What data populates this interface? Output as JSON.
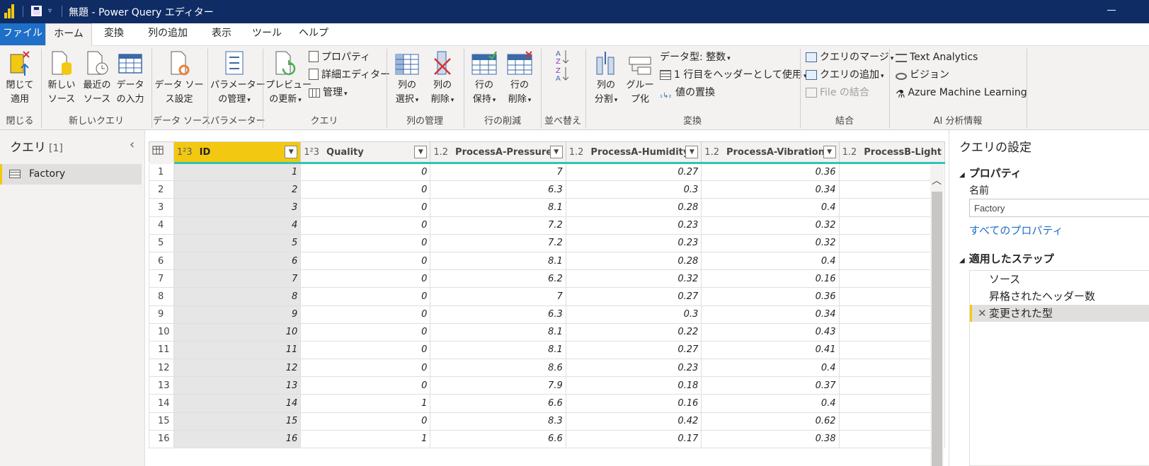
{
  "titlebar": {
    "title": "無題 - Power Query エディター"
  },
  "tabs": [
    "ファイル",
    "ホーム",
    "変換",
    "列の追加",
    "表示",
    "ツール",
    "ヘルプ"
  ],
  "ribbon": {
    "close_apply": "閉じて\n適用",
    "new_source": "新しい\nソース",
    "recent_sources": "最近の\nソース",
    "enter_data": "データ\nの入力",
    "data_source_settings": "データ ソー\nス設定",
    "manage_parameters": "パラメーター\nの管理",
    "refresh_preview": "プレビュー\nの更新",
    "properties": "プロパティ",
    "advanced_editor": "詳細エディター",
    "manage": "管理",
    "choose_columns": "列の\n選択",
    "remove_columns": "列の\n削除",
    "keep_rows": "行の\n保持",
    "remove_rows": "行の\n削除",
    "split_column": "列の\n分割",
    "group_by": "グルー\nプ化",
    "data_type": "データ型: 整数",
    "use_first_row": "1 行目をヘッダーとして使用",
    "replace_values": "値の置換",
    "merge_queries": "クエリのマージ",
    "append_queries": "クエリの追加",
    "combine_files": "File の結合",
    "text_analytics": "Text Analytics",
    "vision": "ビジョン",
    "azure_ml": "Azure Machine Learning",
    "groups": {
      "close": "閉じる",
      "new_query": "新しいクエリ",
      "data_sources": "データ ソース",
      "parameters": "パラメーター",
      "query": "クエリ",
      "manage_columns": "列の管理",
      "reduce_rows": "行の削減",
      "sort": "並べ替え",
      "transform": "変換",
      "combine": "結合",
      "ai_insights": "AI 分析情報"
    }
  },
  "queries": {
    "title": "クエリ",
    "count": "[1]",
    "items": [
      "Factory"
    ]
  },
  "table": {
    "columns": [
      {
        "type": "1²3",
        "name": "ID"
      },
      {
        "type": "1²3",
        "name": "Quality"
      },
      {
        "type": "1.2",
        "name": "ProcessA-Pressure"
      },
      {
        "type": "1.2",
        "name": "ProcessA-Humidity"
      },
      {
        "type": "1.2",
        "name": "ProcessA-Vibration"
      },
      {
        "type": "1.2",
        "name": "ProcessB-Light"
      }
    ],
    "rows": [
      [
        "1",
        "1",
        "0",
        "7",
        "0.27",
        "0.36"
      ],
      [
        "2",
        "2",
        "0",
        "6.3",
        "0.3",
        "0.34"
      ],
      [
        "3",
        "3",
        "0",
        "8.1",
        "0.28",
        "0.4"
      ],
      [
        "4",
        "4",
        "0",
        "7.2",
        "0.23",
        "0.32"
      ],
      [
        "5",
        "5",
        "0",
        "7.2",
        "0.23",
        "0.32"
      ],
      [
        "6",
        "6",
        "0",
        "8.1",
        "0.28",
        "0.4"
      ],
      [
        "7",
        "7",
        "0",
        "6.2",
        "0.32",
        "0.16"
      ],
      [
        "8",
        "8",
        "0",
        "7",
        "0.27",
        "0.36"
      ],
      [
        "9",
        "9",
        "0",
        "6.3",
        "0.3",
        "0.34"
      ],
      [
        "10",
        "10",
        "0",
        "8.1",
        "0.22",
        "0.43"
      ],
      [
        "11",
        "11",
        "0",
        "8.1",
        "0.27",
        "0.41"
      ],
      [
        "12",
        "12",
        "0",
        "8.6",
        "0.23",
        "0.4"
      ],
      [
        "13",
        "13",
        "0",
        "7.9",
        "0.18",
        "0.37"
      ],
      [
        "14",
        "14",
        "1",
        "6.6",
        "0.16",
        "0.4"
      ],
      [
        "15",
        "15",
        "0",
        "8.3",
        "0.42",
        "0.62"
      ],
      [
        "16",
        "16",
        "1",
        "6.6",
        "0.17",
        "0.38"
      ]
    ]
  },
  "settings": {
    "title": "クエリの設定",
    "properties_header": "プロパティ",
    "name_label": "名前",
    "name_value": "Factory",
    "all_properties": "すべてのプロパティ",
    "steps_header": "適用したステップ",
    "steps": [
      "ソース",
      "昇格されたヘッダー数",
      "変更された型"
    ]
  },
  "colors": {
    "titlebar": "#0f2c65",
    "accent": "#f2c811",
    "file_tab": "#1e6fc8",
    "header_line": "#2ec4b6"
  }
}
